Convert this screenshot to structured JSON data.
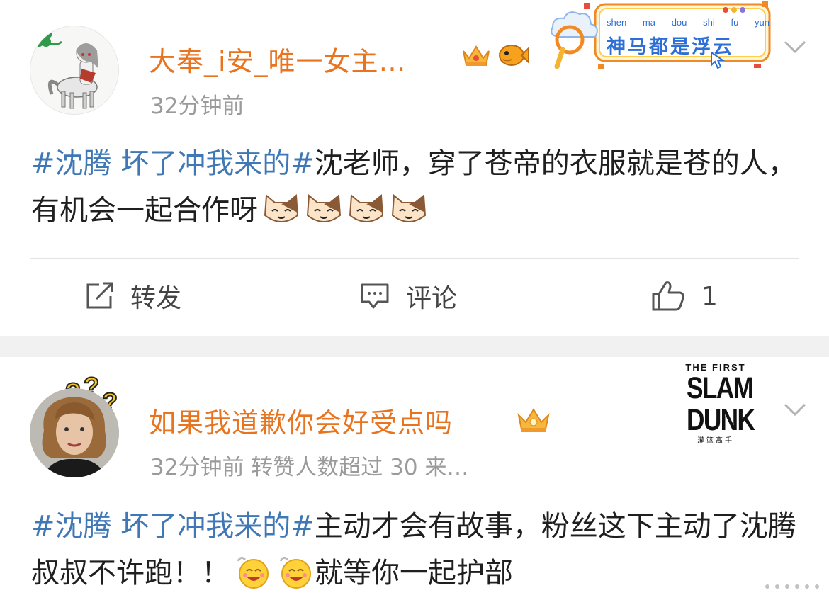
{
  "post1": {
    "username": "大奉_i安_唯一女主…",
    "meta": "32分钟前",
    "banner": {
      "pinyin": [
        "shen",
        "ma",
        "dou",
        "shi",
        "fu",
        "yun"
      ],
      "text": "神马都是浮云"
    },
    "topic": "#沈腾 坏了冲我来的#",
    "text": "沈老师，穿了苍帝的衣服就是苍的人，有机会一起合作呀",
    "emoji_count": 4,
    "actions": {
      "repost_label": "转发",
      "comment_label": "评论",
      "like_count": "1"
    }
  },
  "post2": {
    "username": "如果我道歉你会好受点吗",
    "meta": "32分钟前  转赞人数超过 30  来…",
    "slamdunk": {
      "top": "THE FIRST",
      "line1": "SLAM",
      "line2": "DUNK",
      "cn": "灌篮高手"
    },
    "topic": "#沈腾 坏了冲我来的#",
    "text_a": "主动才会有故事，粉丝这下主动了沈腾叔叔不许跑！！",
    "text_b": "就等你一起护部"
  },
  "colors": {
    "username": "#e8741f",
    "topic": "#3f78b4",
    "meta": "#9a9a9a",
    "separator": "#f1f1f1"
  }
}
